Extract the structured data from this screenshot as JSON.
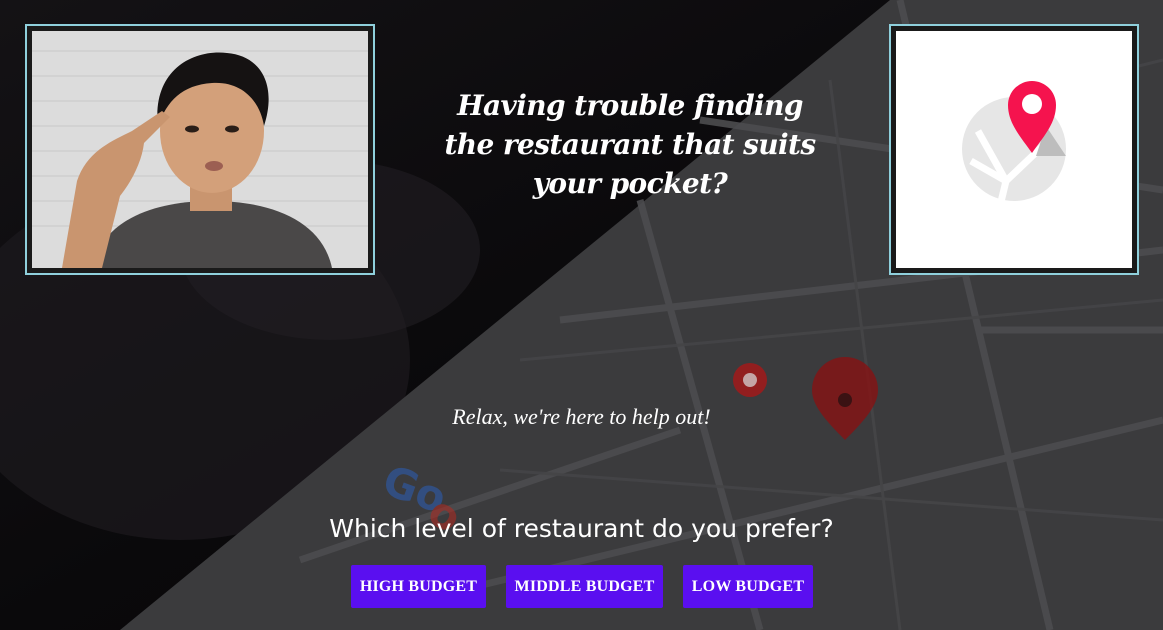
{
  "hero": {
    "headline": "Having trouble finding the restaurant that suits your pocket?",
    "tagline": "Relax, we're here to help out!"
  },
  "budget": {
    "question": "Which level of restaurant do you prefer?",
    "options": [
      {
        "label": "HIGH BUDGET"
      },
      {
        "label": "MIDDLE BUDGET"
      },
      {
        "label": "LOW BUDGET"
      }
    ]
  },
  "images": {
    "left": "thinking-person-photo",
    "right": "map-pin-logo"
  },
  "colors": {
    "button": "#5a0ff0",
    "frame_border": "#8fd0dc",
    "pin": "#f5134e"
  }
}
